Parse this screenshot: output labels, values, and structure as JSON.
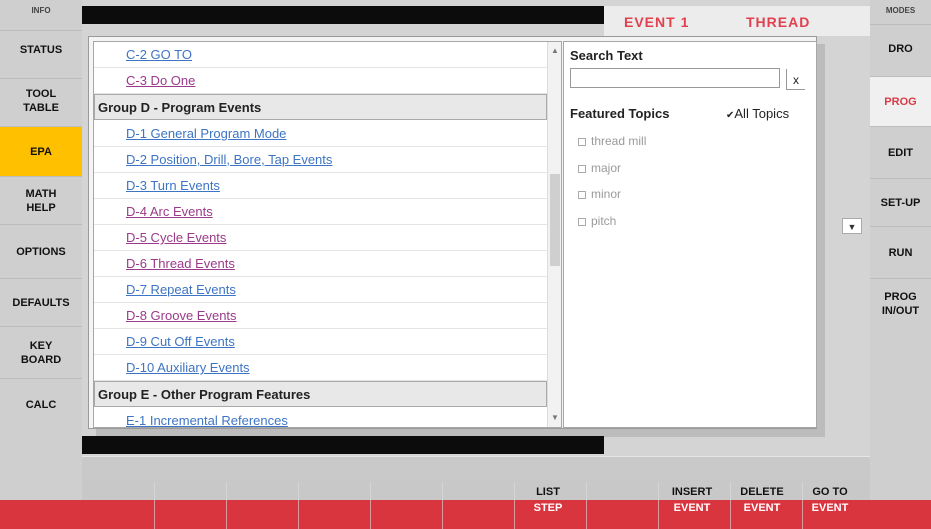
{
  "left_sidebar": {
    "header": "INFO",
    "buttons": [
      "STATUS",
      "TOOL\nTABLE",
      "EPA",
      "MATH\nHELP",
      "OPTIONS",
      "DEFAULTS",
      "KEY\nBOARD",
      "CALC"
    ],
    "active": "EPA"
  },
  "right_sidebar": {
    "header": "MODES",
    "buttons": [
      "DRO",
      "PROG",
      "EDIT",
      "SET-UP",
      "RUN",
      "PROG\nIN/OUT"
    ],
    "active": "PROG"
  },
  "event_header": {
    "event": "EVENT 1",
    "type": "THREAD"
  },
  "topics_list": {
    "rows": [
      {
        "kind": "link",
        "text": "C-2 GO TO",
        "visited": false
      },
      {
        "kind": "link",
        "text": "C-3 Do One",
        "visited": true
      },
      {
        "kind": "group",
        "text": "Group D - Program Events"
      },
      {
        "kind": "link",
        "text": "D-1 General Program Mode",
        "visited": false
      },
      {
        "kind": "link",
        "text": "D-2 Position, Drill, Bore, Tap Events",
        "visited": false
      },
      {
        "kind": "link",
        "text": "D-3 Turn Events",
        "visited": false
      },
      {
        "kind": "link",
        "text": "D-4 Arc Events",
        "visited": true
      },
      {
        "kind": "link",
        "text": "D-5 Cycle Events",
        "visited": true
      },
      {
        "kind": "link",
        "text": "D-6 Thread Events",
        "visited": true
      },
      {
        "kind": "link",
        "text": "D-7 Repeat Events",
        "visited": false
      },
      {
        "kind": "link",
        "text": "D-8 Groove Events",
        "visited": true
      },
      {
        "kind": "link",
        "text": "D-9 Cut Off Events",
        "visited": false
      },
      {
        "kind": "link",
        "text": "D-10 Auxiliary Events",
        "visited": false
      },
      {
        "kind": "group",
        "text": "Group E - Other Program Features"
      },
      {
        "kind": "link",
        "text": "E-1 Incremental References",
        "visited": false
      }
    ],
    "scroll_up_icon": "caret-up",
    "scroll_down_icon": "caret-down"
  },
  "search": {
    "title": "Search Text",
    "input_value": "",
    "clear_label": "x",
    "featured_title": "Featured Topics",
    "all_topics_label": "All Topics",
    "all_topics_checked": true,
    "topics": [
      "thread mill",
      "major",
      "minor",
      "pitch"
    ]
  },
  "bottom_keys": [
    {
      "line1": "LIST",
      "line2": "STEP"
    },
    {
      "line1": "INSERT",
      "line2": "EVENT"
    },
    {
      "line1": "DELETE",
      "line2": "EVENT"
    },
    {
      "line1": "GO TO",
      "line2": "EVENT"
    }
  ],
  "colors": {
    "accent_yellow": "#ffc000",
    "brand_red": "#d9353f",
    "link_blue": "#3d74c4",
    "link_visited": "#9b3a8a"
  }
}
